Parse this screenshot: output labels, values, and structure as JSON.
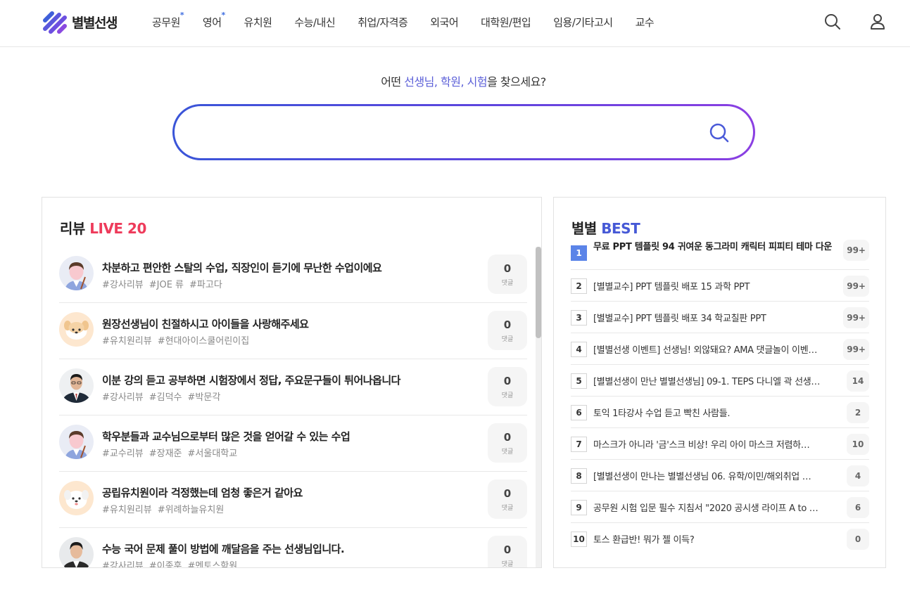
{
  "header": {
    "logo_text": "별별선생",
    "nav": [
      {
        "label": "공무원",
        "star": "*"
      },
      {
        "label": "영어",
        "star": "*"
      },
      {
        "label": "유치원",
        "star": ""
      },
      {
        "label": "수능/내신",
        "star": ""
      },
      {
        "label": "취업/자격증",
        "star": ""
      },
      {
        "label": "외국어",
        "star": ""
      },
      {
        "label": "대학원/편입",
        "star": ""
      },
      {
        "label": "임용/기타고시",
        "star": ""
      },
      {
        "label": "교수",
        "star": ""
      }
    ],
    "icons": [
      "search-icon",
      "user-icon"
    ]
  },
  "search": {
    "question_prefix": "어떤 ",
    "question_highlight": "선생님, 학원, 시험",
    "question_suffix": "을 찾으세요?",
    "input_value": "",
    "input_placeholder": "",
    "button_icon": "search-icon",
    "gradient_colors": [
      "#3a55d8",
      "#5e45de",
      "#8b3fe2"
    ]
  },
  "reviews": {
    "title_prefix": "리뷰 ",
    "title_accent": "LIVE 20",
    "accent_color": "#ee3b5b",
    "comment_label": "댓글",
    "items": [
      {
        "title": "차분하고 편안한 스탈의 수업, 직장인이 듣기에 무난한 수업이에요",
        "tags": [
          "#강사리뷰",
          "#JOE 류",
          "#파고다"
        ],
        "comments": "0",
        "avatar": "teacher-cartoon"
      },
      {
        "title": "원장선생님이 친절하시고 아이들을 사랑해주세요",
        "tags": [
          "#유치원리뷰",
          "#현대아이스쿨어린이집"
        ],
        "comments": "0",
        "avatar": "puppy-cartoon"
      },
      {
        "title": "이분 강의 듣고 공부하면 시험장에서 정답, 주요문구들이 튀어나옵니다",
        "tags": [
          "#강사리뷰",
          "#김덕수",
          "#박문각"
        ],
        "comments": "0",
        "avatar": "teacher-photo"
      },
      {
        "title": "학우분들과 교수님으로부터 많은 것을 얻어갈 수 있는 수업",
        "tags": [
          "#교수리뷰",
          "#장재준",
          "#서울대학교"
        ],
        "comments": "0",
        "avatar": "teacher-cartoon"
      },
      {
        "title": "공립유치원이라 걱정했는데 엄청 좋은거 같아요",
        "tags": [
          "#유치원리뷰",
          "#위례하늘유치원"
        ],
        "comments": "0",
        "avatar": "puppy-cartoon-white"
      },
      {
        "title": "수능 국어 문제 풀이 방법에 깨달음을 주는 선생님입니다.",
        "tags": [
          "#강사리뷰",
          "#이종훈",
          "#멘토스학원"
        ],
        "comments": "0",
        "avatar": "teacher-photo-2"
      }
    ]
  },
  "best": {
    "title_prefix": "별별 ",
    "title_accent": "BEST",
    "accent_color": "#4659d6",
    "items": [
      {
        "rank": "1",
        "title": "무료 PPT 템플릿 94 귀여운 동그라미 캐릭터 피피티 테마 다운",
        "count": "99+"
      },
      {
        "rank": "2",
        "title": "[별별교수] PPT 템플릿 배포 15 과학 PPT",
        "count": "99+"
      },
      {
        "rank": "3",
        "title": "[별별교수] PPT 템플릿 배포 34 학교칠판 PPT",
        "count": "99+"
      },
      {
        "rank": "4",
        "title": "[별별선생 이벤트] 선생님! 외않돼요? AMA 댓글놀이 이벤…",
        "count": "99+"
      },
      {
        "rank": "5",
        "title": "[별별선생이 만난 별별선생님] 09-1. TEPS 다니엘 곽 선생…",
        "count": "14"
      },
      {
        "rank": "6",
        "title": "토익 1타강사 수업 듣고 빡친 사람들.",
        "count": "2"
      },
      {
        "rank": "7",
        "title": "마스크가 아니라 '금'스크 비상! 우리 아이 마스크 저렴하…",
        "count": "10"
      },
      {
        "rank": "8",
        "title": "[별별선생이 만나는 별별선생님 06. 유학/이민/해외취업 …",
        "count": "4"
      },
      {
        "rank": "9",
        "title": "공무원 시험 입문 필수 지침서 \"2020 공시생 라이프 A to …",
        "count": "6"
      },
      {
        "rank": "10",
        "title": "토스 환급반! 뭐가 젤 이득?",
        "count": "0"
      }
    ]
  }
}
